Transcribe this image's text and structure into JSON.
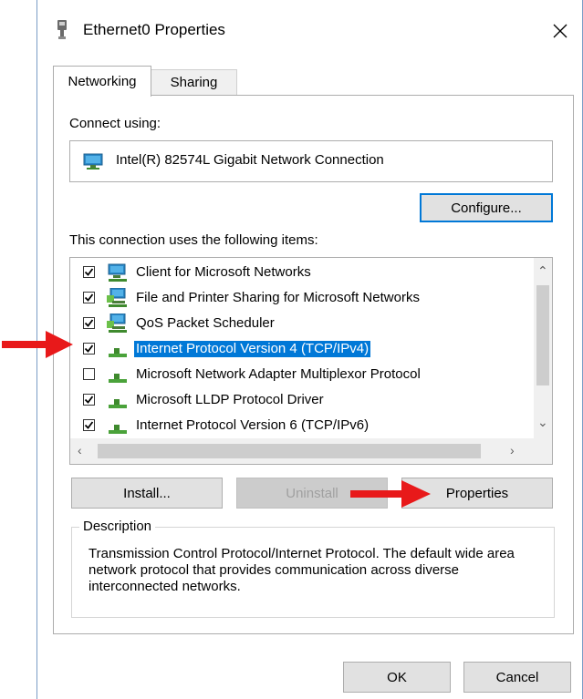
{
  "window": {
    "title": "Ethernet0 Properties",
    "close_glyph": "✕"
  },
  "tabs": [
    {
      "label": "Networking",
      "active": true
    },
    {
      "label": "Sharing",
      "active": false
    }
  ],
  "connect_using": {
    "label": "Connect using:",
    "adapter_name": "Intel(R) 82574L Gigabit Network Connection",
    "icon": "network-adapter-icon"
  },
  "buttons": {
    "configure": "Configure...",
    "install": "Install...",
    "uninstall": "Uninstall",
    "properties": "Properties",
    "ok": "OK",
    "cancel": "Cancel"
  },
  "items_label": "This connection uses the following items:",
  "items": [
    {
      "label": "Client for Microsoft Networks",
      "checked": true,
      "selected": false,
      "icon": "network-client-icon"
    },
    {
      "label": "File and Printer Sharing for Microsoft Networks",
      "checked": true,
      "selected": false,
      "icon": "network-service-icon"
    },
    {
      "label": "QoS Packet Scheduler",
      "checked": true,
      "selected": false,
      "icon": "network-service-icon"
    },
    {
      "label": "Internet Protocol Version 4 (TCP/IPv4)",
      "checked": true,
      "selected": true,
      "icon": "protocol-icon"
    },
    {
      "label": "Microsoft Network Adapter Multiplexor Protocol",
      "checked": false,
      "selected": false,
      "icon": "protocol-icon"
    },
    {
      "label": "Microsoft LLDP Protocol Driver",
      "checked": true,
      "selected": false,
      "icon": "protocol-icon"
    },
    {
      "label": "Internet Protocol Version 6 (TCP/IPv6)",
      "checked": true,
      "selected": false,
      "icon": "protocol-icon"
    }
  ],
  "description": {
    "title": "Description",
    "text": "Transmission Control Protocol/Internet Protocol. The default wide area network protocol that provides communication across diverse interconnected networks."
  },
  "colors": {
    "accent": "#0078d7",
    "annotation_arrow": "#e8191a"
  }
}
